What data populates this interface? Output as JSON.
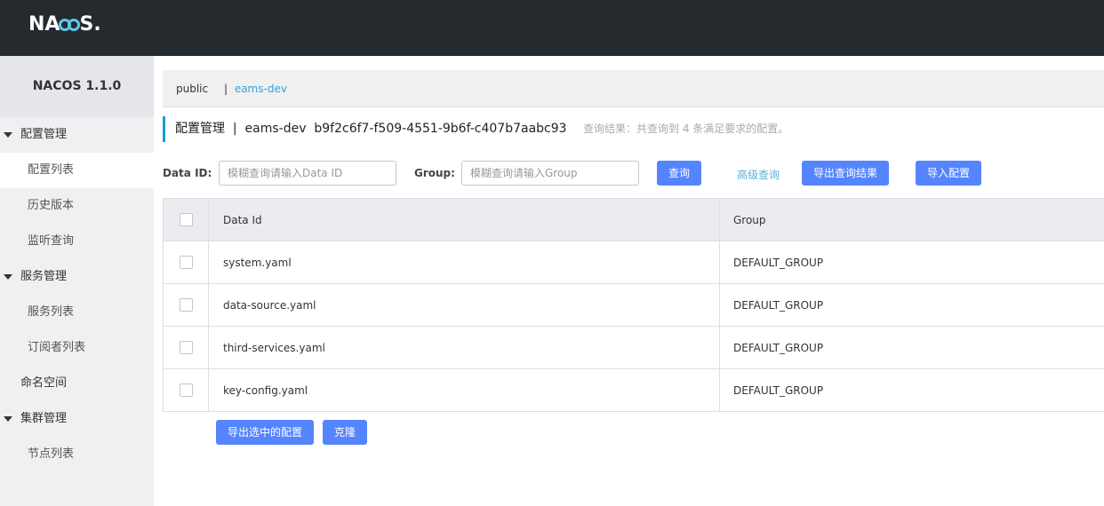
{
  "header": {
    "logo_text_a": "NA",
    "logo_text_b": "S",
    "logo_dot": "."
  },
  "sidebar": {
    "title": "NACOS 1.1.0",
    "items": [
      {
        "label": "配置管理",
        "kind": "group"
      },
      {
        "label": "配置列表",
        "kind": "sub",
        "active": true
      },
      {
        "label": "历史版本",
        "kind": "sub"
      },
      {
        "label": "监听查询",
        "kind": "sub"
      },
      {
        "label": "服务管理",
        "kind": "group"
      },
      {
        "label": "服务列表",
        "kind": "sub"
      },
      {
        "label": "订阅者列表",
        "kind": "sub"
      },
      {
        "label": "命名空间",
        "kind": "plain"
      },
      {
        "label": "集群管理",
        "kind": "group"
      },
      {
        "label": "节点列表",
        "kind": "sub"
      }
    ]
  },
  "namespace_bar": {
    "public": "public",
    "separator": "|",
    "current": "eams-dev"
  },
  "page_title": {
    "text": "配置管理  |  eams-dev  b9f2c6f7-f509-4551-9b6f-c407b7aabc93",
    "hint": "查询结果：共查询到 4 条满足要求的配置。"
  },
  "filters": {
    "data_id_label": "Data ID:",
    "data_id_placeholder": "模糊查询请输入Data ID",
    "group_label": "Group:",
    "group_placeholder": "模糊查询请输入Group",
    "search_button": "查询",
    "advanced_link": "高级查询",
    "export_results_button": "导出查询结果",
    "import_button": "导入配置"
  },
  "table": {
    "columns": [
      "Data Id",
      "Group"
    ],
    "rows": [
      {
        "data_id": "system.yaml",
        "group": "DEFAULT_GROUP"
      },
      {
        "data_id": "data-source.yaml",
        "group": "DEFAULT_GROUP"
      },
      {
        "data_id": "third-services.yaml",
        "group": "DEFAULT_GROUP"
      },
      {
        "data_id": "key-config.yaml",
        "group": "DEFAULT_GROUP"
      }
    ]
  },
  "bottom": {
    "export_selected_button": "导出选中的配置",
    "clone_button": "克隆"
  },
  "colors": {
    "topbar": "#252a2f",
    "primary_button": "#5584ff",
    "accent": "#1b9bd3",
    "link": "#33a3dc"
  }
}
